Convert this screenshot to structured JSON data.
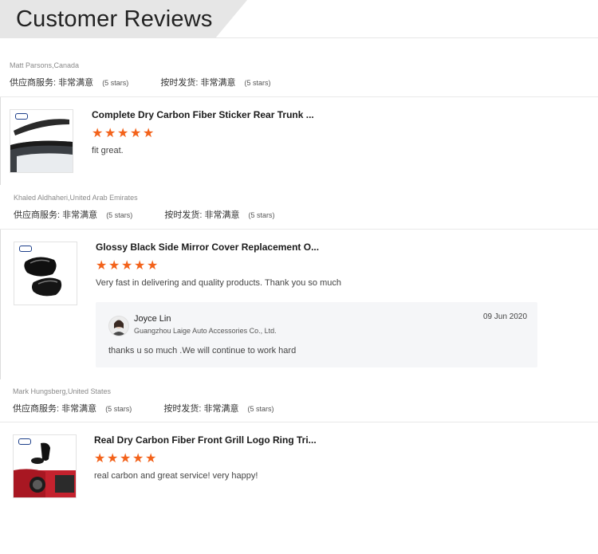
{
  "header": {
    "title": "Customer Reviews"
  },
  "reviews": [
    {
      "reviewer": "Matt Parsons,Canada",
      "supplier_label": "供应商服务:",
      "supplier_value": "非常满意",
      "supplier_stars": "(5 stars)",
      "shipping_label": "按时发货:",
      "shipping_value": "非常满意",
      "shipping_stars": "(5 stars)",
      "product_title": "Complete Dry Carbon Fiber Sticker Rear Trunk ...",
      "rating": 5,
      "comment": "fit great."
    },
    {
      "reviewer": "Khaled Aldhaheri,United Arab Emirates",
      "supplier_label": "供应商服务:",
      "supplier_value": "非常满意",
      "supplier_stars": "(5 stars)",
      "shipping_label": "按时发货:",
      "shipping_value": "非常满意",
      "shipping_stars": "(5 stars)",
      "product_title": "Glossy Black Side Mirror Cover Replacement O...",
      "rating": 5,
      "comment": "Very fast in delivering and quality products. Thank you so much",
      "reply": {
        "name": "Joyce Lin",
        "company": "Guangzhou Laige Auto Accessories Co., Ltd.",
        "date": "09 Jun 2020",
        "text": "thanks u so much .We will continue to work hard"
      }
    },
    {
      "reviewer": "Mark Hungsberg,United States",
      "supplier_label": "供应商服务:",
      "supplier_value": "非常满意",
      "supplier_stars": "(5 stars)",
      "shipping_label": "按时发货:",
      "shipping_value": "非常满意",
      "shipping_stars": "(5 stars)",
      "product_title": "Real Dry Carbon Fiber Front Grill Logo Ring Tri...",
      "rating": 5,
      "comment": "real carbon and great service! very happy!"
    }
  ],
  "colors": {
    "star": "#f3621a",
    "header_tab": "#e6e6e6"
  },
  "icons": {
    "star": "star-icon"
  }
}
